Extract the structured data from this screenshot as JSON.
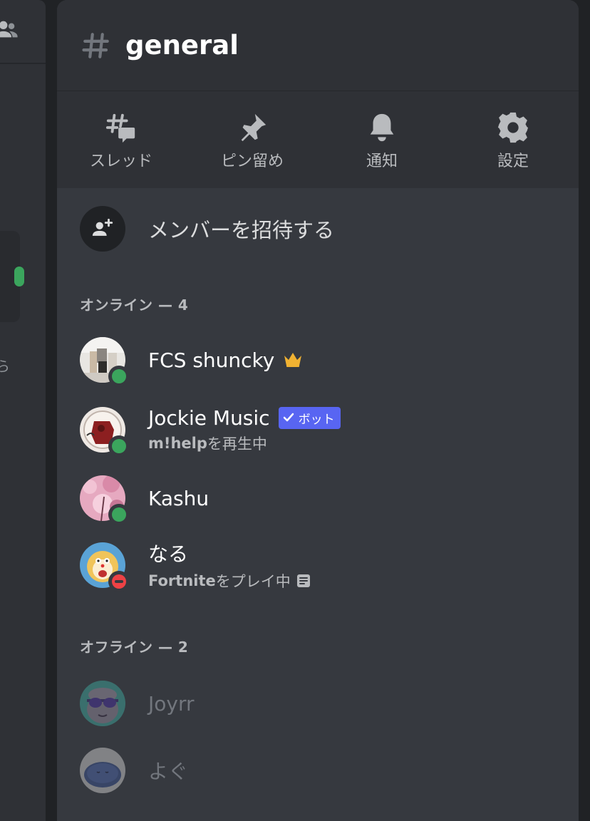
{
  "channel": {
    "name": "general"
  },
  "actions": [
    {
      "label": "スレッド",
      "icon": "threads-icon"
    },
    {
      "label": "ピン留め",
      "icon": "pin-icon"
    },
    {
      "label": "通知",
      "icon": "bell-icon"
    },
    {
      "label": "設定",
      "icon": "gear-icon"
    }
  ],
  "invite": {
    "label": "メンバーを招待する"
  },
  "online_section": {
    "label": "オンライン — 4"
  },
  "offline_section": {
    "label": "オフライン — 2"
  },
  "members_online": [
    {
      "name": "FCS shuncky",
      "status": "online",
      "badge": "crown"
    },
    {
      "name": "Jockie Music",
      "status": "online",
      "badge": "bot",
      "badge_label": "ボット",
      "activity_bold": "m!help",
      "activity_rest": "を再生中"
    },
    {
      "name": "Kashu",
      "status": "online"
    },
    {
      "name": "なる",
      "status": "dnd",
      "activity_bold": "Fortnite",
      "activity_rest": "をプレイ中"
    }
  ],
  "members_offline": [
    {
      "name": "Joyrr"
    },
    {
      "name": "よぐ"
    }
  ],
  "colors": {
    "online": "#3ba55d",
    "dnd": "#ed4245",
    "bot_badge": "#5865f2",
    "crown": "#f0b232"
  }
}
